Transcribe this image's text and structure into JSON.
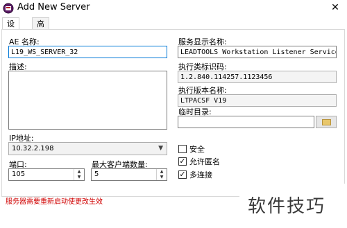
{
  "window": {
    "title": "Add New Server",
    "close_glyph": "✕"
  },
  "tabs": [
    {
      "label": "设置"
    },
    {
      "label": "高级"
    }
  ],
  "ae_name": {
    "label": "AE 名称:",
    "value": "L19_WS_SERVER_32"
  },
  "description": {
    "label": "描述:",
    "value": ""
  },
  "display_name": {
    "label": "服务显示名称:",
    "value": "LEADTOOLS Workstation Listener Service"
  },
  "class_uid": {
    "label": "执行类标识码:",
    "value": "1.2.840.114257.1123456"
  },
  "version_name": {
    "label": "执行版本名称:",
    "value": "LTPACSF V19"
  },
  "temp_dir": {
    "label": "临时目录:",
    "value": ""
  },
  "ip_address": {
    "label": "IP地址:",
    "value": "10.32.2.198"
  },
  "port": {
    "label": "端口:",
    "value": "105"
  },
  "max_clients": {
    "label": "最大客户端数量:",
    "value": "5"
  },
  "options": [
    {
      "label": "安全",
      "checked": false,
      "glyph": ""
    },
    {
      "label": "允许匿名",
      "checked": true,
      "glyph": "✓"
    },
    {
      "label": "多连接",
      "checked": true,
      "glyph": "✓"
    }
  ],
  "status_message": "服务器需要重新启动使更改生效",
  "watermark": "软件技巧"
}
